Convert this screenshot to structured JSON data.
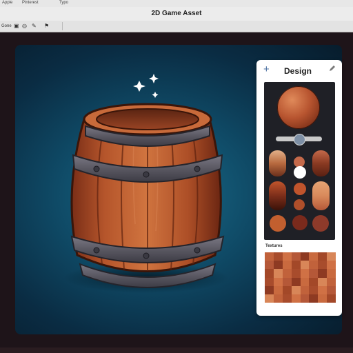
{
  "menubar": {
    "items": [
      "Apple",
      "Pinterest",
      "Typo"
    ]
  },
  "window": {
    "title": "2D Game Asset"
  },
  "toolbar": {
    "items": [
      "Gone",
      "cube-icon",
      "target-icon",
      "brush-icon",
      "bookmark-icon"
    ]
  },
  "panel": {
    "title": "Design",
    "add_icon": "+",
    "edit_icon": "pencil-icon",
    "slider_level": 0.5,
    "textures_label": "Textures",
    "swatches": [
      [
        "#b86a3f",
        "#e2b089",
        "#6b2f1b"
      ],
      [
        "#8a3a22",
        "#ffffff",
        "#c4694a"
      ],
      [
        "#7c2e1a",
        "#c0542c",
        "#d98a5b"
      ],
      [
        "#c25f2f",
        "#7a2a1c",
        "#8d3a2a"
      ]
    ],
    "texture_colors": [
      "#c1623b",
      "#a84c2c",
      "#d07145",
      "#b55838",
      "#8e3a22",
      "#c96a3f",
      "#a34828",
      "#d88658"
    ]
  },
  "canvas": {
    "sparkles": 3
  },
  "colors": {
    "accent": "#4a6fa0",
    "wood": "#b85a2f",
    "metal": "#585660",
    "background": "#0f4a66"
  }
}
